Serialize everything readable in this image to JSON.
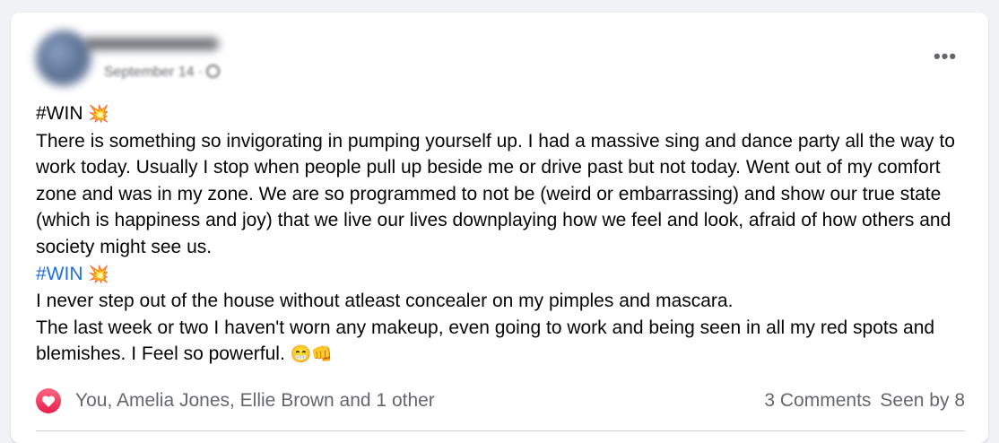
{
  "post": {
    "date_text": "September 14 ·",
    "more_label": "•••",
    "tag1": "#WIN",
    "emoji_boom": "💥",
    "paragraph1": "There is something so invigorating in pumping yourself up. I had a massive sing and dance party all the way to work today. Usually I stop when people pull up beside me or drive past but not today. Went out of my comfort zone and was in my zone. We are so programmed to not be (weird or embarrassing) and show our true state (which is happiness and joy) that we live our lives downplaying how we feel and look, afraid of how others and society might see us.",
    "tag2": "#WIN",
    "paragraph2": "I never step out of the house without atleast concealer on my pimples and mascara.",
    "paragraph3": "The last week or two I haven't worn any makeup, even going to work and being seen in all my red spots and blemishes. I Feel so powerful.",
    "emoji_end": "😁👊"
  },
  "footer": {
    "reaction_names": "You, Amelia Jones, Ellie Brown and 1 other",
    "comments": "3 Comments",
    "seen_by": "Seen by 8"
  },
  "colors": {
    "hashtag": "#216fdb",
    "heart": "#e61e4d",
    "muted_text": "#65676b"
  }
}
